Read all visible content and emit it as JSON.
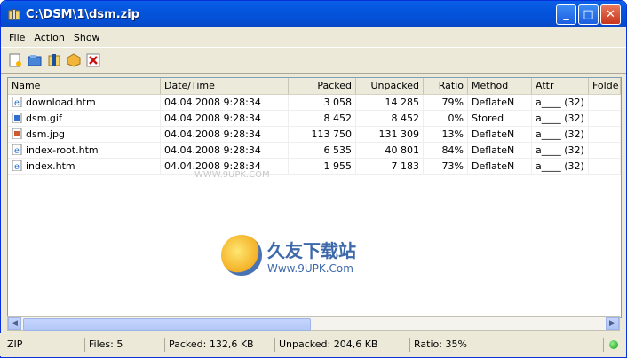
{
  "window": {
    "title": "C:\\DSM\\1\\dsm.zip"
  },
  "menu": [
    "File",
    "Action",
    "Show"
  ],
  "toolbar": [
    {
      "name": "new-archive-icon"
    },
    {
      "name": "open-folder-icon"
    },
    {
      "name": "extract-icon"
    },
    {
      "name": "add-files-icon"
    },
    {
      "name": "delete-icon"
    }
  ],
  "columns": [
    "Name",
    "Date/Time",
    "Packed",
    "Unpacked",
    "Ratio",
    "Method",
    "Attr",
    "Folde"
  ],
  "rows": [
    [
      "download.htm",
      "04.04.2008 9:28:34",
      "3 058",
      "14 285",
      "79%",
      "DeflateN",
      "a____ (32)",
      "",
      ""
    ],
    [
      "dsm.gif",
      "04.04.2008 9:28:34",
      "8 452",
      "8 452",
      "0%",
      "Stored",
      "a____ (32)",
      ""
    ],
    [
      "dsm.jpg",
      "04.04.2008 9:28:34",
      "113 750",
      "131 309",
      "13%",
      "DeflateN",
      "a____ (32)",
      ""
    ],
    [
      "index-root.htm",
      "04.04.2008 9:28:34",
      "6 535",
      "40 801",
      "84%",
      "DeflateN",
      "a____ (32)",
      ""
    ],
    [
      "index.htm",
      "04.04.2008 9:28:34",
      "1 955",
      "7 183",
      "73%",
      "DeflateN",
      "a____ (32)",
      ""
    ]
  ],
  "row_icons": [
    "ie-page-icon",
    "gif-image-icon",
    "jpg-image-icon",
    "ie-page-icon",
    "ie-page-icon"
  ],
  "status": {
    "type": "ZIP",
    "files": "Files: 5",
    "packed": "Packed: 132,6 KB",
    "unpacked": "Unpacked: 204,6 KB",
    "ratio": "Ratio: 35%"
  },
  "watermark": {
    "title": "久友下载站",
    "url": "Www.9UPK.Com",
    "url_small": "WWW.9UPK.COM"
  },
  "colors": {
    "titlebar": "#0454dc",
    "accent": "#7f9db9"
  }
}
